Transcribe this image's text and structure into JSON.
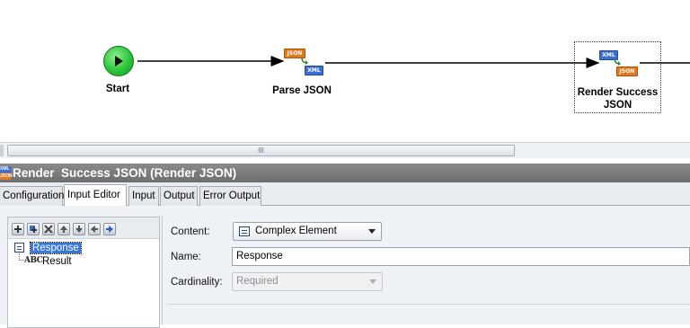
{
  "canvas": {
    "nodes": [
      {
        "id": "start",
        "label": "Start"
      },
      {
        "id": "parse",
        "label": "Parse JSON",
        "icon_top": "JSON",
        "icon_bottom": "XML"
      },
      {
        "id": "render",
        "label_line1": "Render Success",
        "label_line2": "JSON",
        "icon_top": "XML",
        "icon_bottom": "JSON"
      }
    ],
    "scrollbar_grip": "III"
  },
  "panel": {
    "title": "Render  Success JSON (Render JSON)",
    "title_icon_top": "XML",
    "title_icon_bottom": "JSON",
    "tabs": [
      {
        "label": "Configuration",
        "active": false
      },
      {
        "label": "Input Editor",
        "active": true
      },
      {
        "label": "Input",
        "active": false
      },
      {
        "label": "Output",
        "active": false
      },
      {
        "label": "Error Output",
        "active": false
      }
    ]
  },
  "tree": {
    "toolbar": [
      "add-icon",
      "add-child-icon",
      "delete-icon",
      "move-up-icon",
      "move-down-icon",
      "outdent-icon",
      "indent-icon"
    ],
    "items": [
      {
        "label": "Response",
        "icon": "complex-element-icon",
        "selected": true
      },
      {
        "label": "Result",
        "icon": "abc-string-icon",
        "selected": false
      }
    ]
  },
  "form": {
    "content_label": "Content:",
    "content_value": "Complex Element",
    "name_label": "Name:",
    "name_value": "Response",
    "cardinality_label": "Cardinality:",
    "cardinality_value": "Required"
  },
  "colors": {
    "json_tag": "#e07a1f",
    "xml_tag": "#3b6fd1",
    "selection": "#3a78d8",
    "title_bar": "#7a7a7a",
    "start_green": "#2cc43c"
  }
}
